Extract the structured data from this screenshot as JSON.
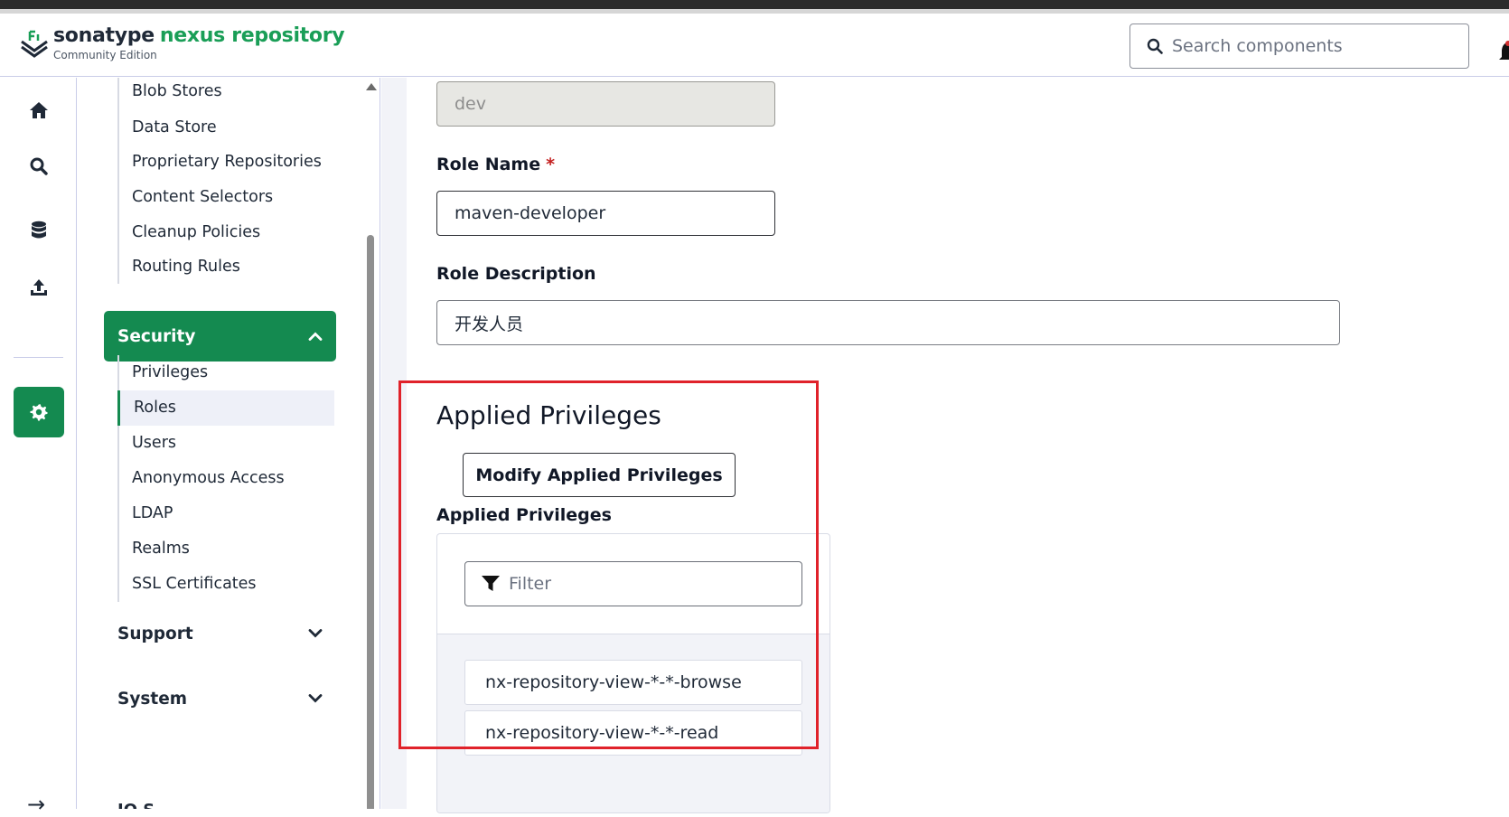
{
  "brand": {
    "name_part1": "sonatype",
    "name_part2": "nexus repository",
    "edition": "Community Edition"
  },
  "search": {
    "placeholder": "Search components",
    "icon": "search-icon"
  },
  "rail": {
    "items": [
      {
        "name": "home",
        "icon": "home-icon"
      },
      {
        "name": "browse",
        "icon": "search-icon"
      },
      {
        "name": "database",
        "icon": "database-icon"
      },
      {
        "name": "upload",
        "icon": "upload-icon"
      },
      {
        "name": "administration",
        "icon": "gear-icon",
        "active": true
      }
    ],
    "accent": "#148a50"
  },
  "sidebar": {
    "repository_items": [
      "Blob Stores",
      "Data Store",
      "Proprietary Repositories",
      "Content Selectors",
      "Cleanup Policies",
      "Routing Rules"
    ],
    "security": {
      "label": "Security",
      "expanded": true,
      "items": [
        "Privileges",
        "Roles",
        "Users",
        "Anonymous Access",
        "LDAP",
        "Realms",
        "SSL Certificates"
      ],
      "active_item": "Roles"
    },
    "support": {
      "label": "Support"
    },
    "system": {
      "label": "System"
    },
    "partial_label": "IQ S"
  },
  "form": {
    "role_id_value": "dev",
    "role_name_label": "Role Name",
    "required_mark": "*",
    "role_name_value": "maven-developer",
    "role_description_label": "Role Description",
    "role_description_value": "开发人员",
    "applied_privileges_title": "Applied Privileges",
    "modify_button": "Modify Applied Privileges",
    "applied_privileges_label": "Applied Privileges",
    "filter_placeholder": "Filter",
    "privileges": [
      "nx-repository-view-*-*-browse",
      "nx-repository-view-*-*-read"
    ]
  },
  "colors": {
    "brand_green": "#1a9e57",
    "highlight_red": "#e0222a"
  }
}
